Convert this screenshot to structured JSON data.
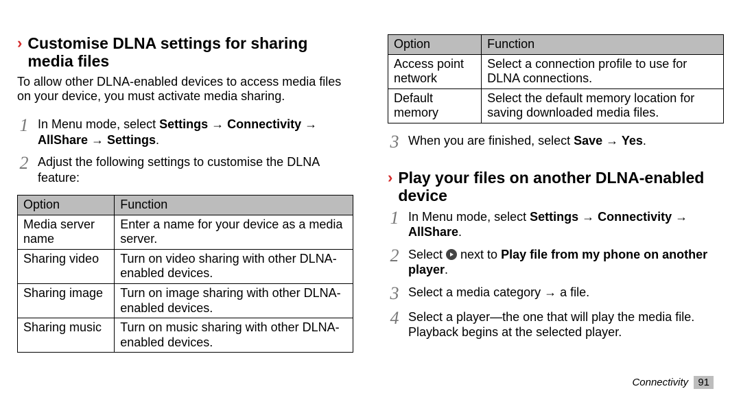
{
  "section1": {
    "title": "Customise DLNA settings for sharing media files",
    "intro": "To allow other DLNA-enabled devices to access media files on your device, you must activate media sharing.",
    "step1_prefix": "In Menu mode, select ",
    "step1_bold": "Settings → Connectivity → AllShare → Settings",
    "step1_suffix": ".",
    "step2": "Adjust the following settings to customise the DLNA feature:"
  },
  "table1": {
    "head_opt": "Option",
    "head_fn": "Function",
    "rows": [
      {
        "opt": "Media server name",
        "fn": "Enter a name for your device as a media server."
      },
      {
        "opt": "Sharing video",
        "fn": "Turn on video sharing with other DLNA-enabled devices."
      },
      {
        "opt": "Sharing image",
        "fn": "Turn on image sharing with other DLNA-enabled devices."
      },
      {
        "opt": "Sharing music",
        "fn": "Turn on music sharing with other DLNA-enabled devices."
      }
    ]
  },
  "table2": {
    "head_opt": "Option",
    "head_fn": "Function",
    "rows": [
      {
        "opt": "Access point network",
        "fn": "Select a connection profile to use for DLNA connections."
      },
      {
        "opt": "Default memory",
        "fn": "Select the default memory location for saving downloaded media files."
      }
    ]
  },
  "step3_prefix": "When you are finished, select ",
  "step3_bold": "Save → Yes",
  "step3_suffix": ".",
  "section2": {
    "title": "Play your files on another DLNA-enabled device",
    "step1_prefix": "In Menu mode, select ",
    "step1_bold": "Settings → Connectivity → AllShare",
    "step1_suffix": ".",
    "step2_prefix1": "Select ",
    "step2_prefix2": " next to ",
    "step2_bold": "Play file from my phone on another player",
    "step2_suffix": ".",
    "step3": "Select a media category → a file.",
    "step4": "Select a player—the one that will play the media file. Playback begins at the selected player."
  },
  "footer": {
    "section": "Connectivity",
    "page": "91"
  }
}
